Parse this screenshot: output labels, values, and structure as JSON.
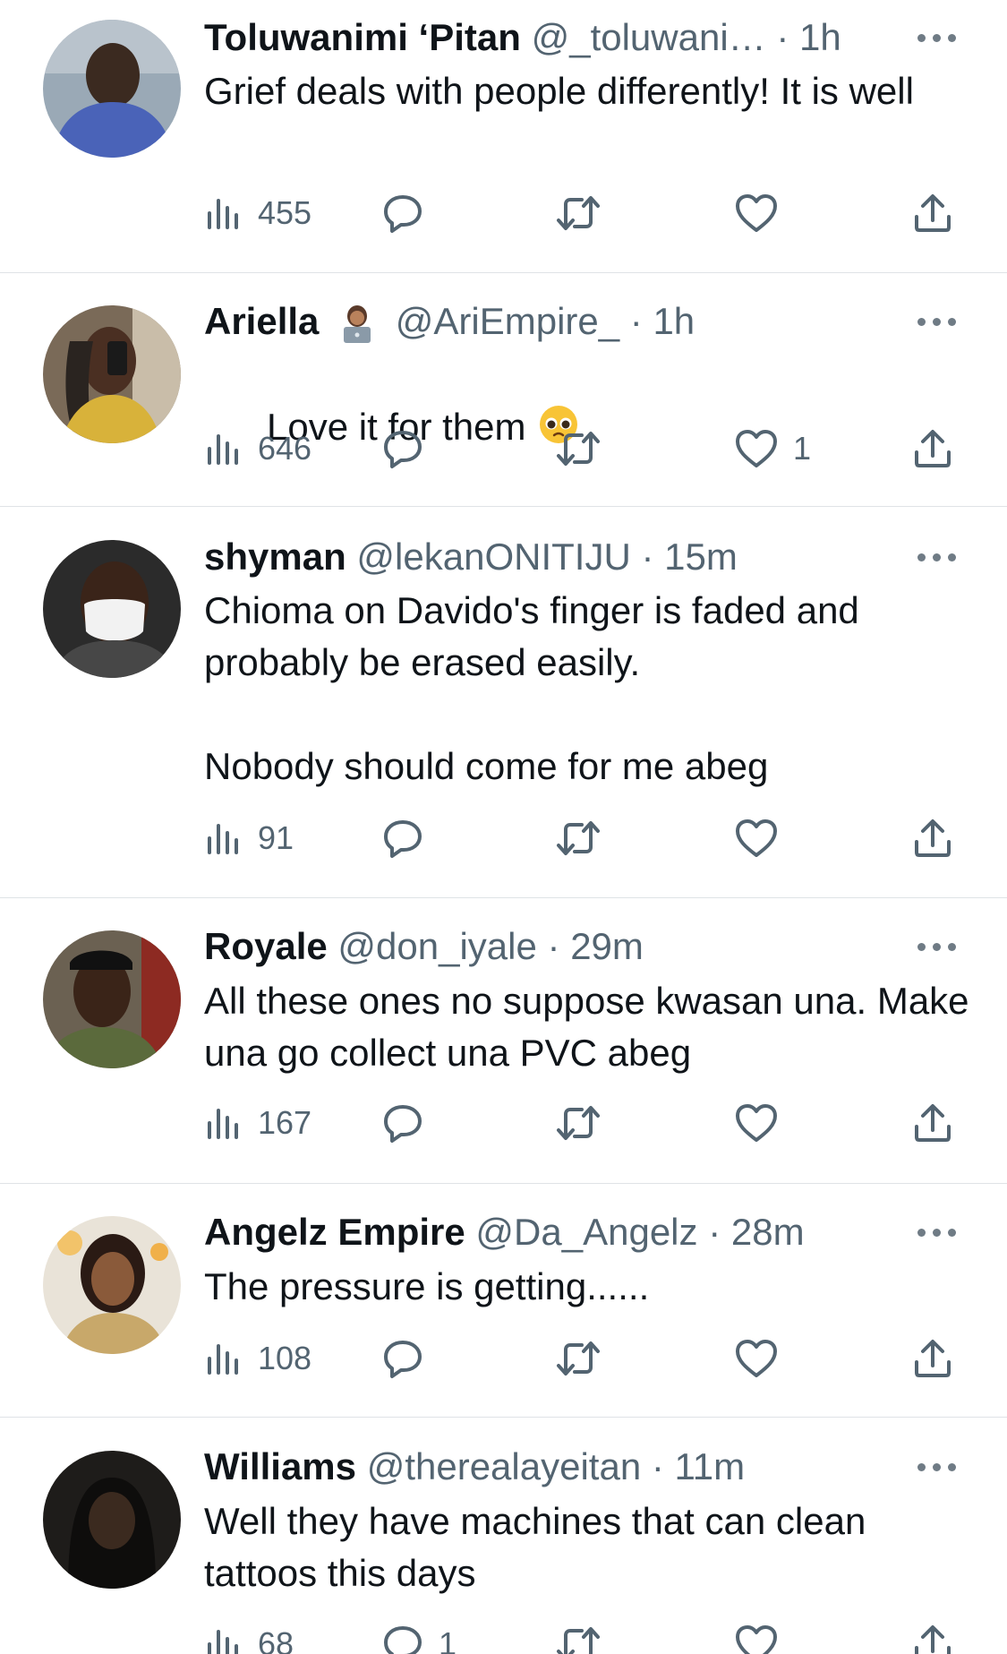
{
  "colors": {
    "text": "#0f1419",
    "muted": "#536471",
    "divider": "#dfe3e6",
    "icon": "#536471"
  },
  "icons": {
    "views": "bar-chart-icon",
    "reply": "speech-bubble-icon",
    "retweet": "retweet-arrows-icon",
    "like": "heart-icon",
    "share": "share-upload-icon",
    "more": "three-dots-icon"
  },
  "tweets": [
    {
      "name": "Toluwanimi ‘Pitan",
      "handle": "@_toluwani…",
      "sep": "·",
      "time": "1h",
      "text": "Grief deals with people differently! It is well",
      "views": "455",
      "replies": "",
      "likes": ""
    },
    {
      "name": "Ariella",
      "name_emoji": "woman-technologist-emoji",
      "handle": "@AriEmpire_",
      "sep": "·",
      "time": "1h",
      "text": "Love it for them",
      "text_emoji": "pleading-face-emoji",
      "views": "646",
      "replies": "",
      "likes": "1"
    },
    {
      "name": "shyman",
      "handle": "@lekanONITIJU",
      "sep": "·",
      "time": "15m",
      "text": "Chioma on Davido's finger is faded and probably be erased easily.\n\nNobody should come for me abeg",
      "views": "91",
      "replies": "",
      "likes": ""
    },
    {
      "name": "Royale",
      "handle": "@don_iyale",
      "sep": "·",
      "time": "29m",
      "text": "All these ones no suppose kwasan una. Make una go collect una PVC abeg",
      "views": "167",
      "replies": "",
      "likes": ""
    },
    {
      "name": "Angelz Empire",
      "handle": "@Da_Angelz",
      "sep": "·",
      "time": "28m",
      "text": "The pressure is getting......",
      "views": "108",
      "replies": "",
      "likes": ""
    },
    {
      "name": "Williams",
      "handle": "@therealayeitan",
      "sep": "·",
      "time": "11m",
      "text": "Well they have machines that can clean tattoos this days",
      "views": "68",
      "replies": "1",
      "likes": ""
    }
  ]
}
